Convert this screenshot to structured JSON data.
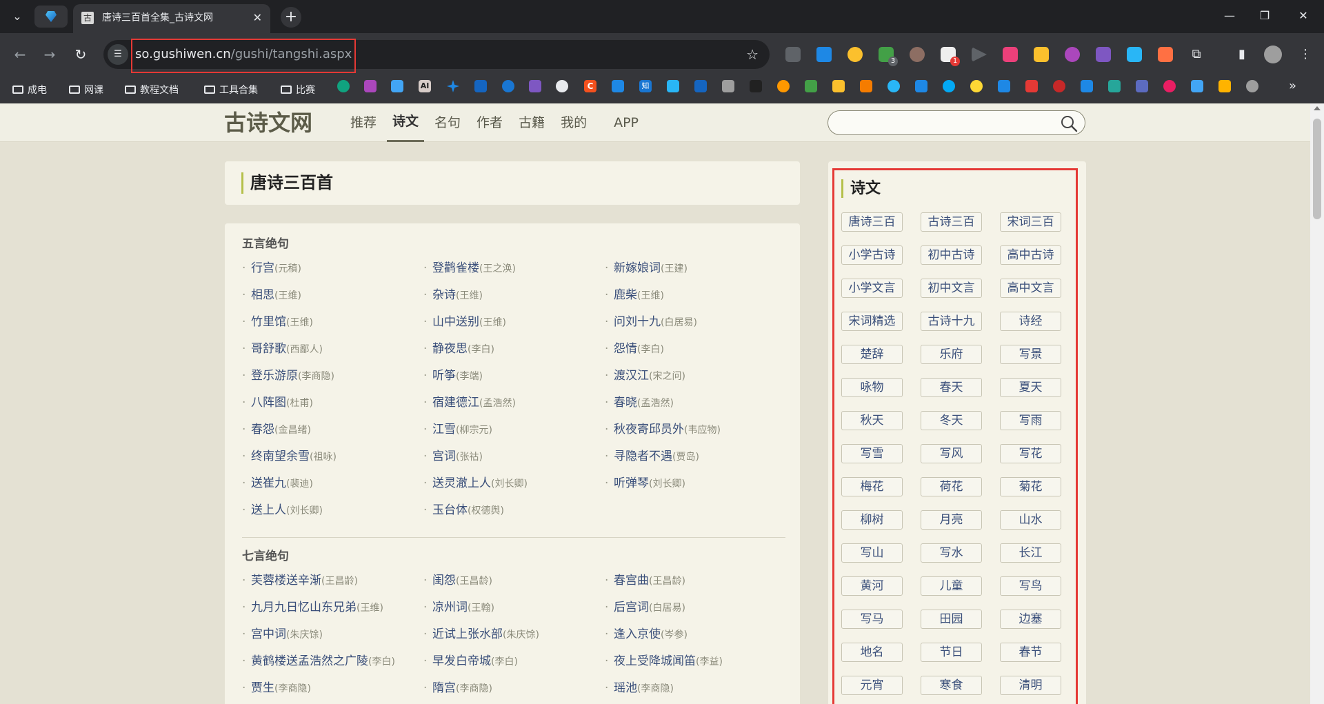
{
  "browser": {
    "tab_title": "唐诗三百首全集_古诗文网",
    "tab_favicon_glyph": "古",
    "url_host": "so.gushiwen.cn",
    "url_path": "/gushi/tangshi.aspx",
    "extension_badges": {
      "shield": "3",
      "media": "1"
    },
    "bookmark_folders": [
      "成电",
      "网课",
      "教程文档",
      "工具合集",
      "比赛"
    ],
    "bookmark_icons_sample": [
      "AI",
      "C",
      "知"
    ]
  },
  "site": {
    "logo": "古诗文网",
    "nav": [
      "推荐",
      "诗文",
      "名句",
      "作者",
      "古籍",
      "我的",
      "APP"
    ],
    "active_nav": "诗文",
    "search_placeholder": ""
  },
  "main": {
    "page_title": "唐诗三百首",
    "sections": [
      {
        "title": "五言绝句",
        "poems": [
          {
            "title": "行宫",
            "author": "(元稹)"
          },
          {
            "title": "登鹳雀楼",
            "author": "(王之涣)"
          },
          {
            "title": "新嫁娘词",
            "author": "(王建)"
          },
          {
            "title": "相思",
            "author": "(王维)"
          },
          {
            "title": "杂诗",
            "author": "(王维)"
          },
          {
            "title": "鹿柴",
            "author": "(王维)"
          },
          {
            "title": "竹里馆",
            "author": "(王维)"
          },
          {
            "title": "山中送别",
            "author": "(王维)"
          },
          {
            "title": "问刘十九",
            "author": "(白居易)"
          },
          {
            "title": "哥舒歌",
            "author": "(西鄙人)"
          },
          {
            "title": "静夜思",
            "author": "(李白)"
          },
          {
            "title": "怨情",
            "author": "(李白)"
          },
          {
            "title": "登乐游原",
            "author": "(李商隐)"
          },
          {
            "title": "听筝",
            "author": "(李端)"
          },
          {
            "title": "渡汉江",
            "author": "(宋之问)"
          },
          {
            "title": "八阵图",
            "author": "(杜甫)"
          },
          {
            "title": "宿建德江",
            "author": "(孟浩然)"
          },
          {
            "title": "春晓",
            "author": "(孟浩然)"
          },
          {
            "title": "春怨",
            "author": "(金昌绪)"
          },
          {
            "title": "江雪",
            "author": "(柳宗元)"
          },
          {
            "title": "秋夜寄邱员外",
            "author": "(韦应物)"
          },
          {
            "title": "终南望余雪",
            "author": "(祖咏)"
          },
          {
            "title": "宫词",
            "author": "(张祜)"
          },
          {
            "title": "寻隐者不遇",
            "author": "(贾岛)"
          },
          {
            "title": "送崔九",
            "author": "(裴迪)"
          },
          {
            "title": "送灵澈上人",
            "author": "(刘长卿)"
          },
          {
            "title": "听弹琴",
            "author": "(刘长卿)"
          },
          {
            "title": "送上人",
            "author": "(刘长卿)"
          },
          {
            "title": "玉台体",
            "author": "(权德舆)"
          }
        ]
      },
      {
        "title": "七言绝句",
        "poems": [
          {
            "title": "芙蓉楼送辛渐",
            "author": "(王昌龄)"
          },
          {
            "title": "闺怨",
            "author": "(王昌龄)"
          },
          {
            "title": "春宫曲",
            "author": "(王昌龄)"
          },
          {
            "title": "九月九日忆山东兄弟",
            "author": "(王维)"
          },
          {
            "title": "凉州词",
            "author": "(王翰)"
          },
          {
            "title": "后宫词",
            "author": "(白居易)"
          },
          {
            "title": "宫中词",
            "author": "(朱庆馀)"
          },
          {
            "title": "近试上张水部",
            "author": "(朱庆馀)"
          },
          {
            "title": "逢入京使",
            "author": "(岑参)"
          },
          {
            "title": "黄鹤楼送孟浩然之广陵",
            "author": "(李白)"
          },
          {
            "title": "早发白帝城",
            "author": "(李白)"
          },
          {
            "title": "夜上受降城闻笛",
            "author": "(李益)"
          },
          {
            "title": "贾生",
            "author": "(李商隐)"
          },
          {
            "title": "隋宫",
            "author": "(李商隐)"
          },
          {
            "title": "瑶池",
            "author": "(李商隐)"
          }
        ]
      }
    ]
  },
  "sidebar": {
    "title": "诗文",
    "tags": [
      "唐诗三百",
      "古诗三百",
      "宋词三百",
      "小学古诗",
      "初中古诗",
      "高中古诗",
      "小学文言",
      "初中文言",
      "高中文言",
      "宋词精选",
      "古诗十九",
      "诗经",
      "楚辞",
      "乐府",
      "写景",
      "咏物",
      "春天",
      "夏天",
      "秋天",
      "冬天",
      "写雨",
      "写雪",
      "写风",
      "写花",
      "梅花",
      "荷花",
      "菊花",
      "柳树",
      "月亮",
      "山水",
      "写山",
      "写水",
      "长江",
      "黄河",
      "儿童",
      "写鸟",
      "写马",
      "田园",
      "边塞",
      "地名",
      "节日",
      "春节",
      "元宵",
      "寒食",
      "清明"
    ]
  },
  "colors": {
    "page_bg": "#e4e1d3",
    "card_bg": "#f5f3e8",
    "link": "#3a4f7a",
    "accent_bar": "#b5c04b",
    "highlight_box": "#e53935"
  }
}
